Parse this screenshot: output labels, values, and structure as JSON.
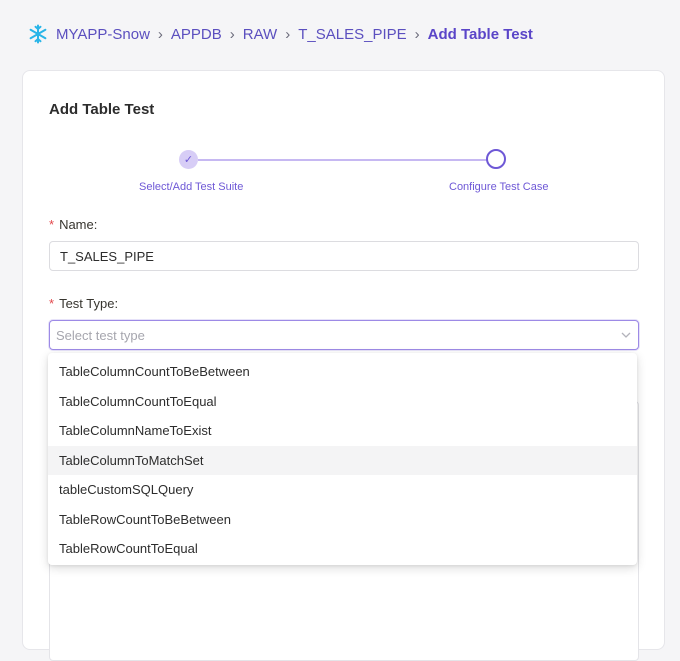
{
  "breadcrumb": {
    "items": [
      "MYAPP-Snow",
      "APPDB",
      "RAW",
      "T_SALES_PIPE"
    ],
    "current": "Add Table Test"
  },
  "card": {
    "title": "Add Table Test",
    "steps": [
      {
        "label": "Select/Add Test Suite",
        "state": "done"
      },
      {
        "label": "Configure Test Case",
        "state": "active"
      }
    ],
    "name_field": {
      "label": "Name:",
      "value": "T_SALES_PIPE"
    },
    "test_type_field": {
      "label": "Test Type:",
      "placeholder": "Select test type"
    }
  },
  "dropdown": {
    "options": [
      "TableColumnCountToBeBetween",
      "TableColumnCountToEqual",
      "TableColumnNameToExist",
      "TableColumnToMatchSet",
      "tableCustomSQLQuery",
      "TableRowCountToBeBetween",
      "TableRowCountToEqual"
    ],
    "highlighted_index": 3
  },
  "colors": {
    "accent": "#6e58d6",
    "required": "#e2474b",
    "snowflake": "#29b5e8"
  }
}
